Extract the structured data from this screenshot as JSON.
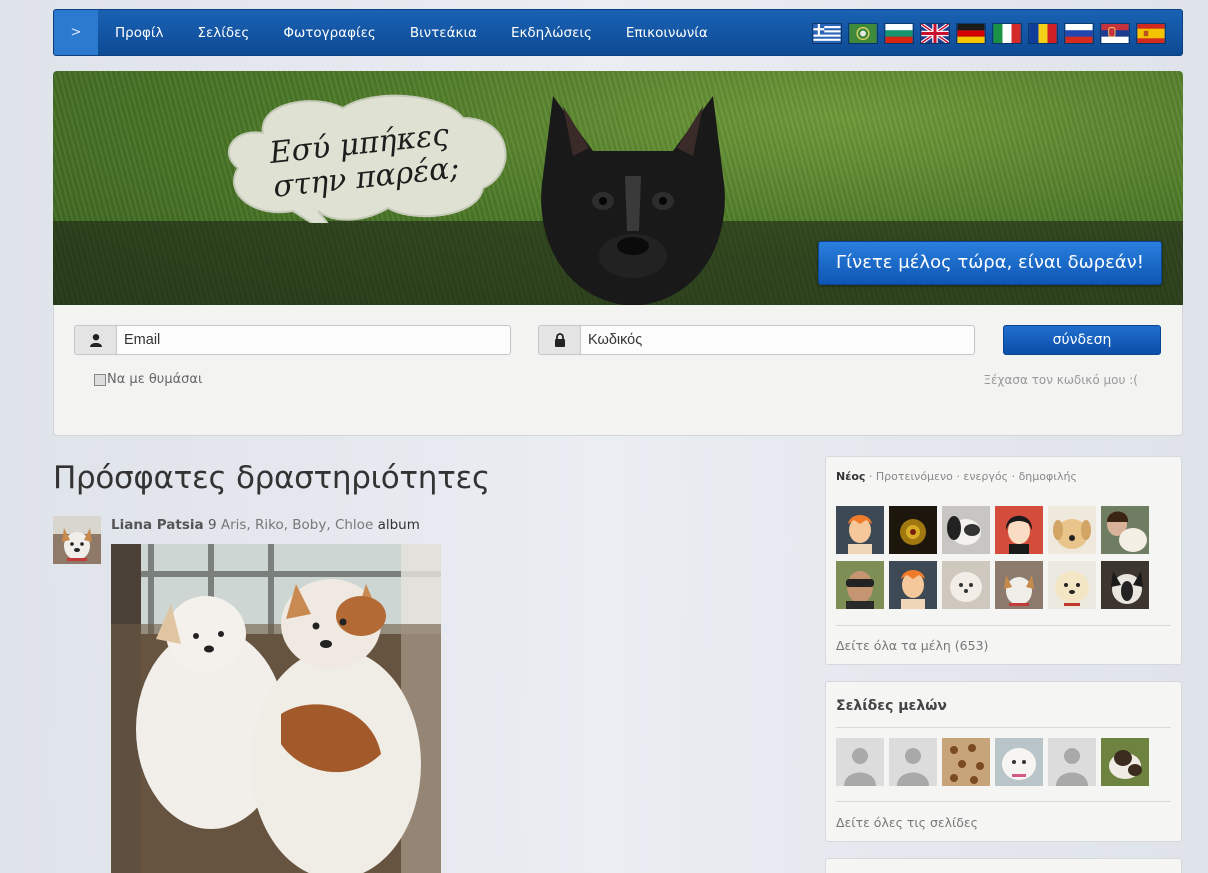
{
  "nav": {
    "home_label": ">",
    "items": [
      "Προφίλ",
      "Σελίδες",
      "Φωτογραφίες",
      "Βιντεάκια",
      "Εκδηλώσεις",
      "Επικοινωνία"
    ],
    "flags": [
      "greek",
      "arabic",
      "bulgarian",
      "english",
      "german",
      "italian",
      "romanian",
      "russian",
      "serbian",
      "spanish"
    ]
  },
  "hero": {
    "bubble_text": "Εσύ μπήκες στην παρέα;",
    "join_button": "Γίνετε μέλος τώρα, είναι δωρεάν!"
  },
  "login": {
    "email_placeholder": "Email",
    "password_placeholder": "Κωδικός",
    "submit": "σύνδεση",
    "remember": "Να με θυμάσαι",
    "forgot": "Ξέχασα τον κωδικό μου :("
  },
  "activity": {
    "title": "Πρόσφατες δραστηριότητες",
    "user": "Liana Patsia",
    "count": "9",
    "tags": "Aris, Riko, Boby, Chloe",
    "album": "album"
  },
  "members": {
    "tab_new": "Νέος",
    "tab_rest": " · Προτεινόμενο · ενεργός · δημοφιλής",
    "see_all": "Δείτε όλα τα μέλη (653)"
  },
  "pages": {
    "title": "Σελίδες μελών",
    "see_all": "Δείτε όλες τις σελίδες"
  },
  "colors": {
    "nav_blue": "#0d4a94",
    "button_blue": "#1f6fcf",
    "grass_green": "#4d7a28"
  }
}
